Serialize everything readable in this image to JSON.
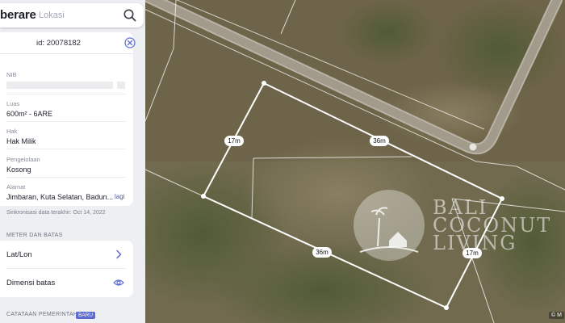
{
  "app": {
    "brand": "berare"
  },
  "search": {
    "placeholder": "Lokasi"
  },
  "parcel": {
    "id_text": "id: 20078182",
    "fields": [
      {
        "label": "NIB",
        "value": ""
      },
      {
        "label": "Luas",
        "value": "600m² - 6ARE"
      },
      {
        "label": "Hak",
        "value": "Hak Milik"
      },
      {
        "label": "Pengelolaan",
        "value": "Kosong"
      },
      {
        "label": "Alamat",
        "value": "Jimbaran, Kuta Selatan, Badun..."
      }
    ],
    "more_link": "lagi",
    "sync_text": "Sinkronisasi data terakhir: Oct 14, 2022"
  },
  "meter_section": {
    "title": "METER DAN BATAS",
    "rows": [
      {
        "label": "Lat/Lon",
        "icon": "chevron-right-icon"
      },
      {
        "label": "Dimensi batas",
        "icon": "eye-icon"
      }
    ]
  },
  "gov_section": {
    "title": "CATATAAN PEMERINTAH",
    "badge": "BARU"
  },
  "map": {
    "dimension_labels": [
      "17m",
      "36m",
      "36m",
      "17m"
    ],
    "watermark": {
      "lines": [
        "BALI",
        "COCONUT",
        "LIVING"
      ]
    },
    "attribution": "© M"
  },
  "colors": {
    "accent": "#5b6bd0",
    "panel_bg": "#eeeff3",
    "parcel_outline": "#ffffff"
  }
}
